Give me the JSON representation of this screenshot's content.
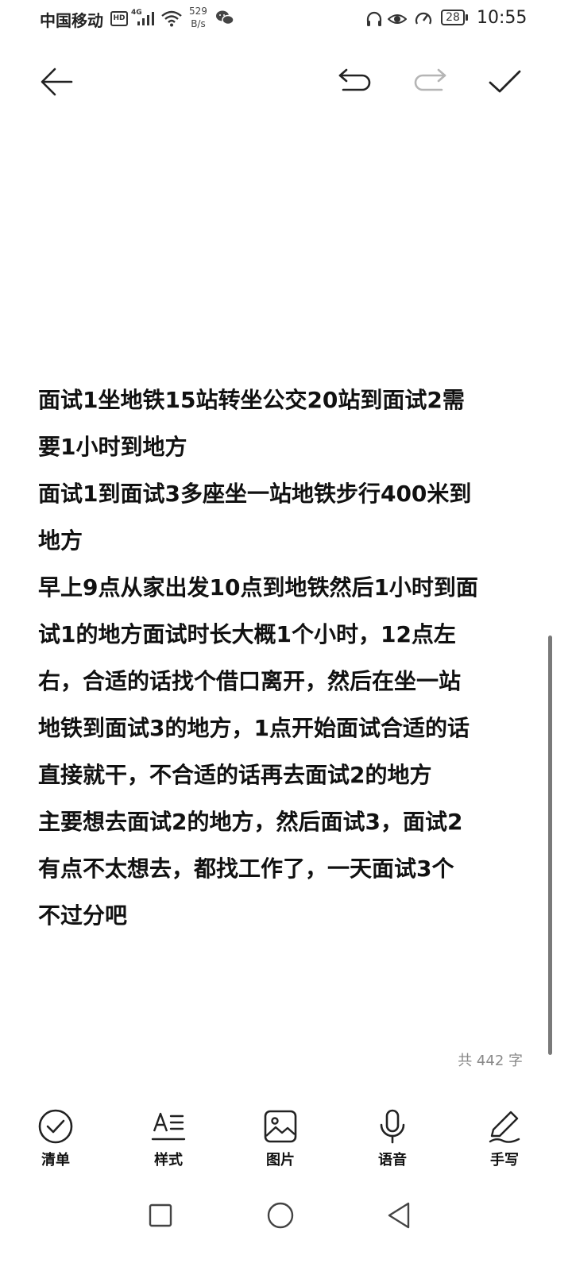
{
  "status_bar": {
    "carrier": "中国移动",
    "hd_badge": "HD",
    "network": "4G",
    "speed_value": "529",
    "speed_unit": "B/s",
    "battery": "28",
    "time": "10:55",
    "icons": [
      "headphones-icon",
      "eye-icon",
      "speed-dial-icon",
      "wifi-icon",
      "signal-icon",
      "wechat-icon"
    ]
  },
  "toolbar": {
    "back_icon": "arrow-left-icon",
    "undo_icon": "undo-icon",
    "redo_icon": "redo-icon",
    "confirm_icon": "checkmark-icon",
    "redo_enabled": false
  },
  "note": {
    "lines": [
      "面试1坐地铁15站转坐公交20站到面试2需",
      "要1小时到地方",
      "面试1到面试3多座坐一站地铁步行400米到",
      "地方",
      "早上9点从家出发10点到地铁然后1小时到面",
      "试1的地方面试时长大概1个小时，12点左",
      "右，合适的话找个借口离开，然后在坐一站",
      "地铁到面试3的地方，1点开始面试合适的话",
      "直接就干，不合适的话再去面试2的地方",
      "主要想去面试2的地方，然后面试3，面试2",
      "有点不太想去，都找工作了，一天面试3个",
      "不过分吧"
    ],
    "word_count": "共 442 字"
  },
  "bottom_tools": [
    {
      "label": "清单",
      "icon": "checklist-icon"
    },
    {
      "label": "样式",
      "icon": "text-style-icon"
    },
    {
      "label": "图片",
      "icon": "image-icon"
    },
    {
      "label": "语音",
      "icon": "microphone-icon"
    },
    {
      "label": "手写",
      "icon": "handwriting-icon"
    }
  ],
  "nav_bar": {
    "recents_icon": "square-icon",
    "home_icon": "circle-icon",
    "back_icon": "triangle-back-icon"
  },
  "colors": {
    "text": "#111111",
    "muted": "#888888",
    "disabled": "#b5b5b5",
    "background": "#ffffff"
  }
}
